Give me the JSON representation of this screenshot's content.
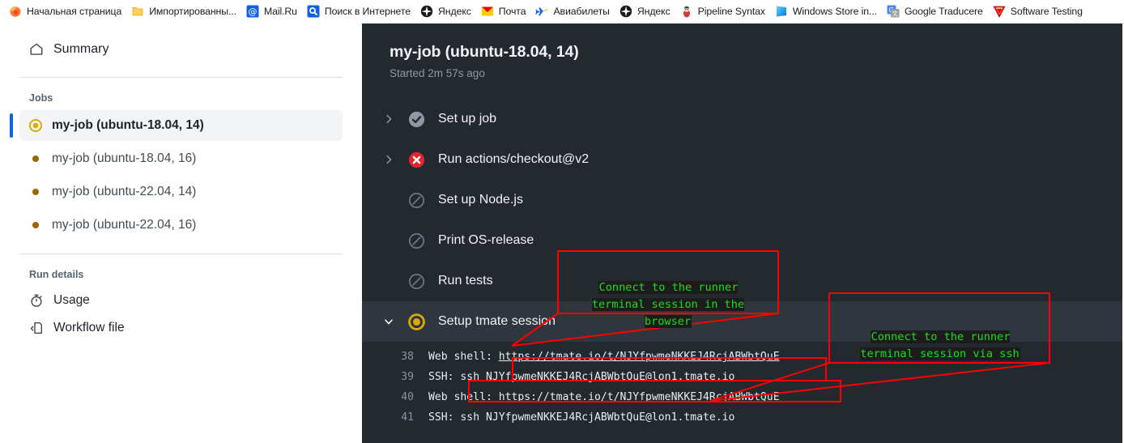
{
  "browser": {
    "bookmarks": [
      {
        "label": "Начальная страница",
        "icon": "firefox-icon",
        "color": "#ff7139"
      },
      {
        "label": "Импортированны...",
        "icon": "folder-icon",
        "color": "#ffc83d"
      },
      {
        "label": "Mail.Ru",
        "icon": "mailru-icon",
        "color": "#1a73e8"
      },
      {
        "label": "Поиск в Интернете",
        "icon": "search-icon",
        "color": "#1061e8"
      },
      {
        "label": "Яндекс",
        "icon": "yandex-icon",
        "color": "#1a1a1a"
      },
      {
        "label": "Почта",
        "icon": "mail-icon",
        "color": "#ffcc00"
      },
      {
        "label": "Авиабилеты",
        "icon": "airplane-icon",
        "color": "#1a73e8"
      },
      {
        "label": "Яндекс",
        "icon": "yandex-icon",
        "color": "#1a1a1a"
      },
      {
        "label": "Pipeline Syntax",
        "icon": "jenkins-icon",
        "color": "#b0413e"
      },
      {
        "label": "Windows Store in...",
        "icon": "windows-store-icon",
        "color": "#00a2ed"
      },
      {
        "label": "Google Traducere",
        "icon": "google-translate-icon",
        "color": "#4285f4"
      },
      {
        "label": "Software Testing",
        "icon": "triangle-icon",
        "color": "#e60000"
      }
    ]
  },
  "sidebar": {
    "summary": {
      "label": "Summary",
      "icon": "home-icon"
    },
    "jobs_heading": "Jobs",
    "jobs": [
      {
        "label": "my-job (ubuntu-18.04, 14)",
        "status": "in-progress",
        "selected": true
      },
      {
        "label": "my-job (ubuntu-18.04, 16)",
        "status": "queued",
        "selected": false
      },
      {
        "label": "my-job (ubuntu-22.04, 14)",
        "status": "queued",
        "selected": false
      },
      {
        "label": "my-job (ubuntu-22.04, 16)",
        "status": "queued",
        "selected": false
      }
    ],
    "run_details_heading": "Run details",
    "run_details": [
      {
        "label": "Usage",
        "icon": "stopwatch-icon"
      },
      {
        "label": "Workflow file",
        "icon": "workflow-file-icon"
      }
    ]
  },
  "main": {
    "title": "my-job (ubuntu-18.04, 14)",
    "started": "Started 2m 57s ago",
    "steps": [
      {
        "label": "Set up job",
        "status": "success",
        "expandable": true,
        "active": false
      },
      {
        "label": "Run actions/checkout@v2",
        "status": "failure",
        "expandable": true,
        "active": false
      },
      {
        "label": "Set up Node.js",
        "status": "skipped",
        "expandable": false,
        "active": false
      },
      {
        "label": "Print OS-release",
        "status": "skipped",
        "expandable": false,
        "active": false
      },
      {
        "label": "Run tests",
        "status": "skipped",
        "expandable": false,
        "active": false
      },
      {
        "label": "Setup tmate session",
        "status": "in-progress",
        "expandable": true,
        "active": true,
        "expanded": true
      }
    ],
    "log_lines": [
      {
        "number": "38",
        "prefix": "Web shell: ",
        "link": "https://tmate.io/t/NJYfpwmeNKKEJ4RcjABWbtQuE",
        "suffix": ""
      },
      {
        "number": "39",
        "prefix": "SSH: ",
        "link": "",
        "suffix": "ssh NJYfpwmeNKKEJ4RcjABWbtQuE@lon1.tmate.io"
      },
      {
        "number": "40",
        "prefix": "Web shell: ",
        "link": "https://tmate.io/t/NJYfpwmeNKKEJ4RcjABWbtQuE",
        "suffix": ""
      },
      {
        "number": "41",
        "prefix": "SSH: ",
        "link": "",
        "suffix": "ssh NJYfpwmeNKKEJ4RcjABWbtQuE@lon1.tmate.io"
      }
    ]
  },
  "annotations": [
    {
      "id": "web-shell-callout",
      "text": "Connect to the runner\nterminal session in the\nbrowser",
      "color": "#18e018",
      "border": "#ff0000"
    },
    {
      "id": "ssh-callout",
      "text": "Connect to the runner\nterminal session via ssh",
      "color": "#18e018",
      "border": "#ff0000"
    }
  ],
  "colors": {
    "accent_blue": "#0969da",
    "panel_dark": "#24292f",
    "row_active": "#2f363d",
    "status_success": "#848d97",
    "status_failure": "#e5232f",
    "status_progress": "#dbab0a",
    "annotation_red": "#ff0000",
    "annotation_green": "#18e018"
  }
}
